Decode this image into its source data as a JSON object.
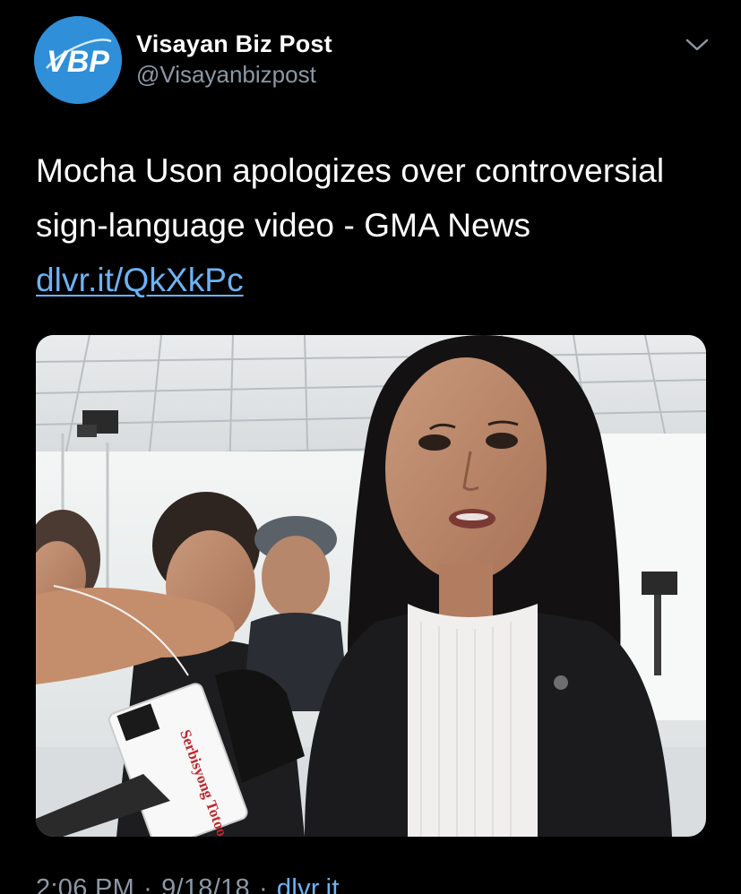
{
  "author": {
    "avatar_text": "VBP",
    "display_name": "Visayan Biz Post",
    "handle": "@Visayanbizpost",
    "icon": "vbp-logo-icon"
  },
  "menu": {
    "icon": "chevron-down-icon"
  },
  "tweet": {
    "text": "Mocha Uson apologizes over controversial sign-language video - GMA News ",
    "link_text": "dlvr.it/QkXkPc"
  },
  "media": {
    "microphone_label": "Serbisyong Totoo"
  },
  "meta": {
    "time": "2:06 PM",
    "separator": "·",
    "date": "9/18/18",
    "source": "dlvr.it"
  },
  "colors": {
    "background": "#000000",
    "text": "#ffffff",
    "secondary": "#8b98a5",
    "link": "#6cb3f5",
    "avatar": "#2f8fd8"
  }
}
